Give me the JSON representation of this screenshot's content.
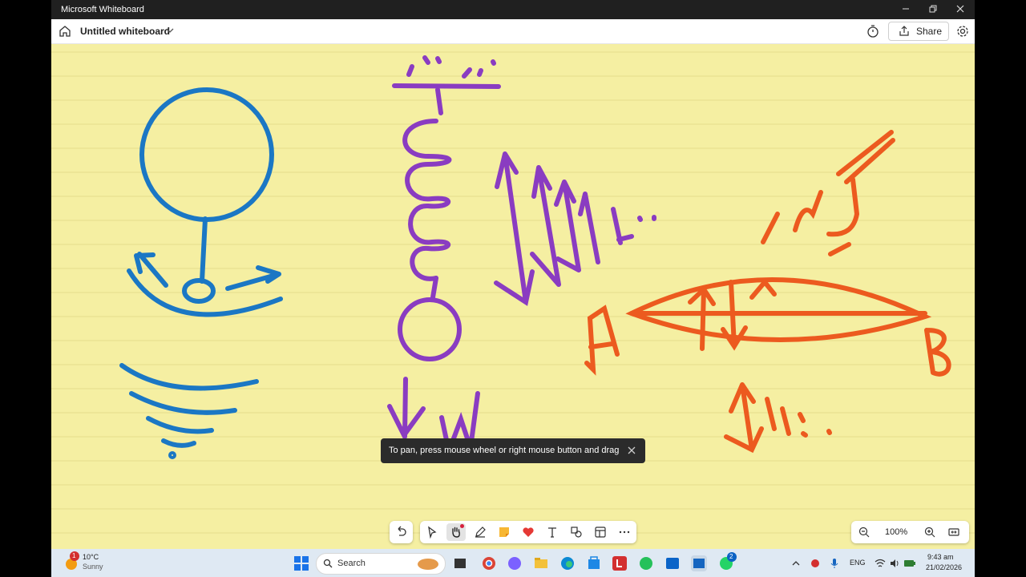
{
  "window": {
    "title": "Microsoft Whiteboard",
    "minimize_icon": "minimize-icon",
    "restore_icon": "restore-icon",
    "close_icon": "close-icon"
  },
  "appbar": {
    "doc_title": "Untitled whiteboard",
    "share_label": "Share"
  },
  "canvas": {
    "background_color": "#f5efa2",
    "ink_colors": {
      "blue": "#1b77c4",
      "purple": "#8a3cc1",
      "orange": "#ec5a1f"
    }
  },
  "toast": {
    "message": "To pan, press mouse wheel or right mouse button and drag"
  },
  "toolbar": {
    "tools": [
      "undo-icon",
      "select-icon",
      "pan-hand-icon",
      "pen-icon",
      "sticky-note-icon",
      "reaction-icon",
      "text-icon",
      "shapes-icon",
      "templates-icon",
      "more-icon"
    ]
  },
  "zoom": {
    "level": "100%"
  },
  "taskbar": {
    "weather": {
      "temp": "10°C",
      "desc": "Sunny",
      "alert_count": "1"
    },
    "search_label": "Search",
    "whatsapp_badge": "2",
    "language": "ENG",
    "time": "9:43 am",
    "date": "21/02/2026"
  }
}
